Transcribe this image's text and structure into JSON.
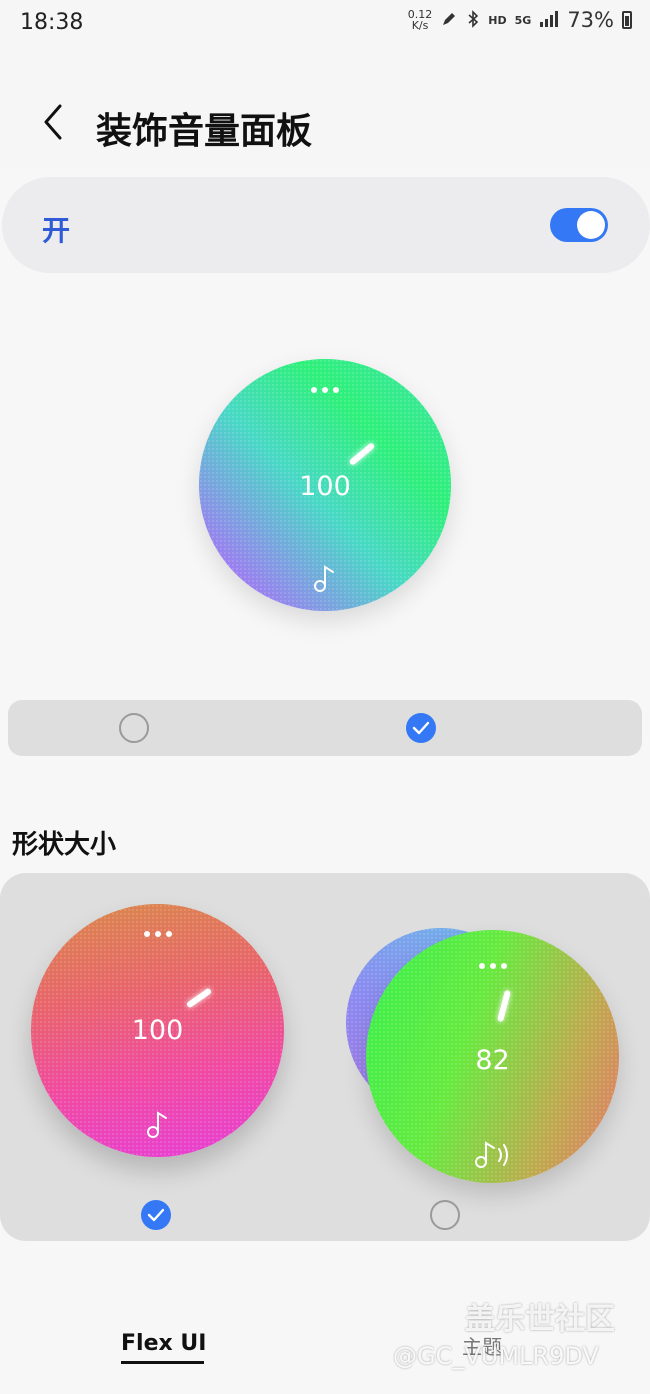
{
  "status_bar": {
    "time": "18:38",
    "net_speed_value": "0.12",
    "net_speed_unit": "K/s",
    "hd": "HD",
    "network": "5G",
    "battery_percent": "73%"
  },
  "header": {
    "title": "装饰音量面板"
  },
  "master_switch": {
    "label": "开",
    "on": true,
    "accent": "#3478f6"
  },
  "preview": {
    "level": "100"
  },
  "style_options": [
    {
      "selected": false
    },
    {
      "selected": true
    }
  ],
  "size_section": {
    "title": "形状大小",
    "options": [
      {
        "level": "100",
        "selected": true
      },
      {
        "level": "82",
        "selected": false
      }
    ]
  },
  "tabs": {
    "flex": "Flex UI",
    "theme": "主题"
  },
  "watermark": {
    "line1": "盖乐世社区",
    "line2": "@GC_VUMLR9DV"
  }
}
